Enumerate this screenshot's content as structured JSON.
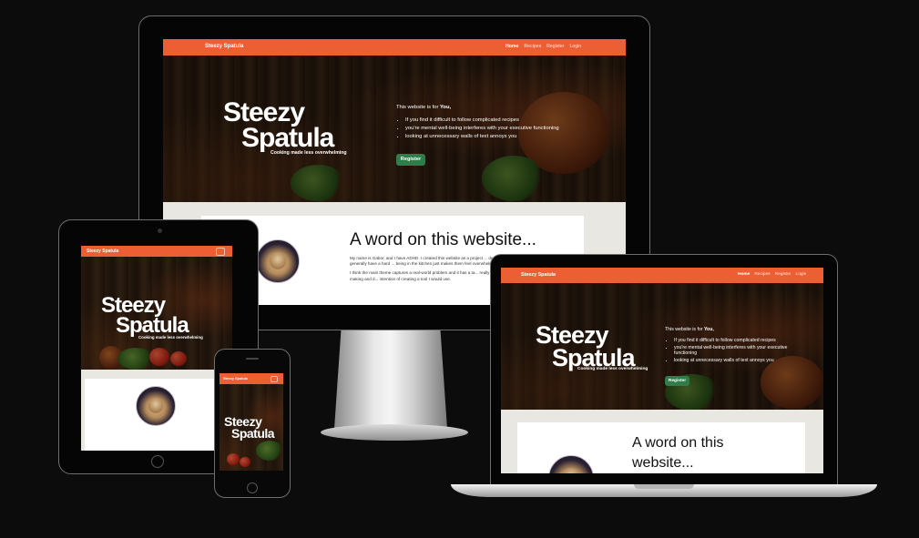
{
  "site": {
    "brand": "Steezy Spatula",
    "nav_links": [
      "Home",
      "Recipes",
      "Register",
      "Login"
    ],
    "logo_line1": "Steezy",
    "logo_line2": "Spatula",
    "tagline": "Cooking made less overwhelming",
    "hero_intro_prefix": "This website is for ",
    "hero_intro_emph": "You,",
    "hero_points": [
      "If you find it difficult to follow complicated recipes",
      "you're mental well-being interferes with your executive functioning",
      "looking at unnecessary walls of text annoys you"
    ],
    "register_button": "Register",
    "about_title": "A word on this website...",
    "about_title_line1": "A word on this",
    "about_title_line2": "website...",
    "about_p1": "My name is Gabor, and I have ADHD. I created this website as a project ... depression, impaired executive functioning or generally have a hard ... being in the kitchen just makes them feel overwhelmed.",
    "about_p2": "I think the main theme captures a real-world problem and it has a ta... really benefit from a website like this. I really enjoyed making and d... intention of creating a tool I would use."
  },
  "colors": {
    "nav": "#ec5f34",
    "register": "#2e7d4a",
    "backdrop": "#0c0c0c"
  }
}
